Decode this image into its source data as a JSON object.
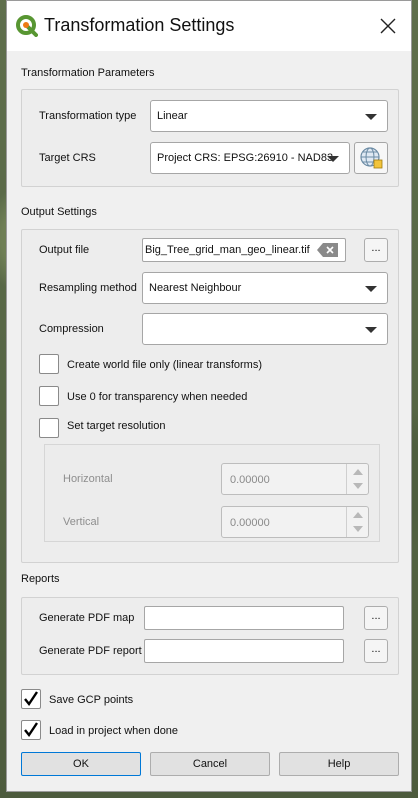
{
  "window": {
    "title": "Transformation Settings"
  },
  "transformation_parameters": {
    "section_label": "Transformation Parameters",
    "transformation_type_label": "Transformation type",
    "transformation_type_value": "Linear",
    "target_crs_label": "Target CRS",
    "target_crs_value": "Project CRS: EPSG:26910 - NAD83"
  },
  "output_settings": {
    "section_label": "Output Settings",
    "output_file_label": "Output file",
    "output_file_value": "Big_Tree_grid_man_geo_linear.tif",
    "browse_label": "...",
    "resampling_label": "Resampling method",
    "resampling_value": "Nearest Neighbour",
    "compression_label": "Compression",
    "compression_value": "",
    "world_file_label": "Create world file only (linear transforms)",
    "transparency_label": "Use 0 for transparency when needed",
    "target_resolution_label": "Set target resolution",
    "horizontal_label": "Horizontal",
    "horizontal_value": "0.00000",
    "vertical_label": "Vertical",
    "vertical_value": "0.00000"
  },
  "reports": {
    "section_label": "Reports",
    "pdf_map_label": "Generate PDF map",
    "pdf_map_value": "",
    "pdf_report_label": "Generate PDF report",
    "pdf_report_value": "",
    "browse_label": "..."
  },
  "options": {
    "save_gcp_label": "Save GCP points",
    "save_gcp_checked": true,
    "load_project_label": "Load in project when done",
    "load_project_checked": true
  },
  "buttons": {
    "ok": "OK",
    "cancel": "Cancel",
    "help": "Help"
  },
  "colors": {
    "qgis_green": "#589632",
    "qgis_yellow": "#ee7913",
    "accent": "#0078d7"
  }
}
